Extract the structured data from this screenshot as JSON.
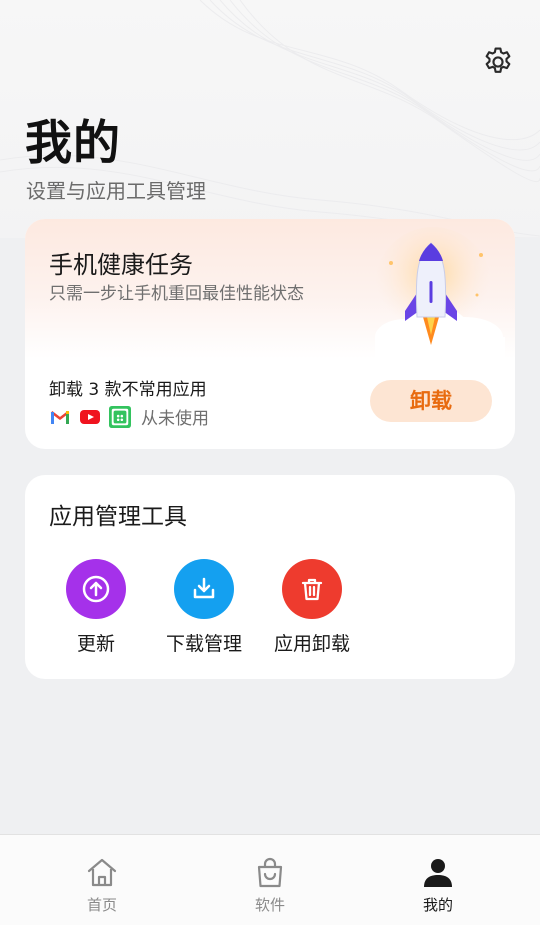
{
  "header": {
    "title": "我的",
    "subtitle": "设置与应用工具管理",
    "settings_icon": "gear-icon"
  },
  "health_card": {
    "title": "手机健康任务",
    "description": "只需一步让手机重回最佳性能状态",
    "task_text": "卸载 3 款不常用应用",
    "apps": [
      "gmail-icon",
      "youtube-icon",
      "app-market-icon"
    ],
    "usage_note": "从未使用",
    "button_label": "卸载",
    "accent_color": "#e86b10"
  },
  "tools_card": {
    "title": "应用管理工具",
    "tools": [
      {
        "label": "更新",
        "icon": "arrow-up-icon",
        "color": "#a531ea"
      },
      {
        "label": "下载管理",
        "icon": "download-icon",
        "color": "#14a0f0"
      },
      {
        "label": "应用卸载",
        "icon": "trash-icon",
        "color": "#ee3b2e"
      }
    ]
  },
  "bottom_nav": {
    "items": [
      {
        "label": "首页",
        "icon": "home-icon"
      },
      {
        "label": "软件",
        "icon": "shopping-bag-icon"
      },
      {
        "label": "我的",
        "icon": "person-icon",
        "active": true
      }
    ]
  }
}
